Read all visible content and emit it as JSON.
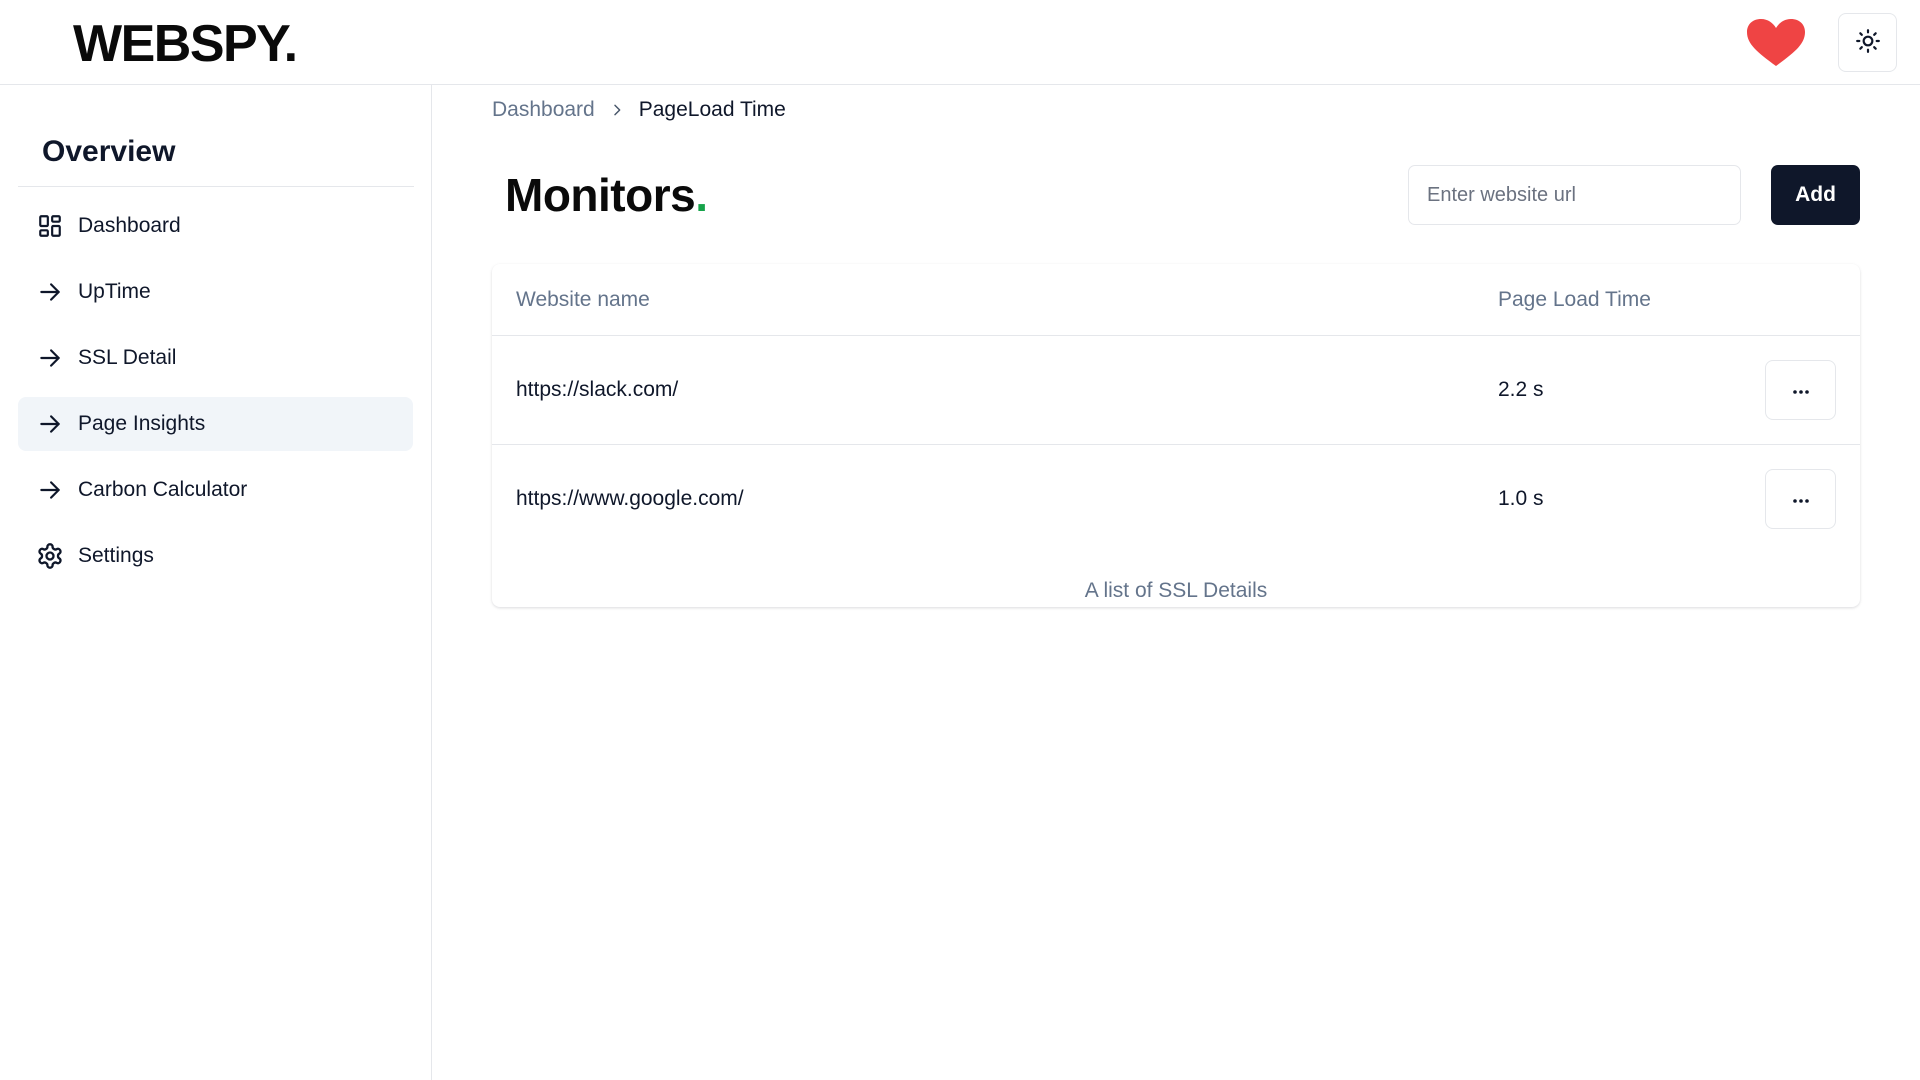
{
  "header": {
    "logo": "WEBSPY.",
    "heart_icon": "heart-icon",
    "theme_icon": "sun-icon"
  },
  "sidebar": {
    "title": "Overview",
    "items": [
      {
        "label": "Dashboard",
        "icon": "dashboard-grid-icon"
      },
      {
        "label": "UpTime",
        "icon": "arrow-right-icon"
      },
      {
        "label": "SSL Detail",
        "icon": "arrow-right-icon"
      },
      {
        "label": "Page Insights",
        "icon": "arrow-right-icon",
        "active": true
      },
      {
        "label": "Carbon Calculator",
        "icon": "arrow-right-icon"
      },
      {
        "label": "Settings",
        "icon": "gear-icon"
      }
    ]
  },
  "breadcrumb": {
    "parent": "Dashboard",
    "current": "PageLoad Time"
  },
  "main": {
    "title": "Monitors",
    "title_dot": ".",
    "url_input": {
      "placeholder": "Enter website url",
      "value": ""
    },
    "add_label": "Add"
  },
  "table": {
    "columns": [
      "Website name",
      "Page Load Time"
    ],
    "rows": [
      {
        "website": "https://slack.com/",
        "load_time": "2.2 s"
      },
      {
        "website": "https://www.google.com/",
        "load_time": "1.0 s"
      }
    ],
    "caption": "A list of SSL Details"
  },
  "colors": {
    "accent_dark": "#0f172a",
    "heart": "#ef4444",
    "title_dot": "#16a34a",
    "active_bg": "#f1f5f9"
  }
}
